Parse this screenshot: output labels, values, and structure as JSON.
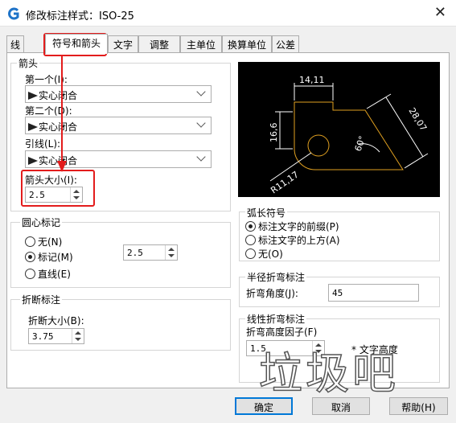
{
  "window": {
    "title": "修改标注样式：ISO-25",
    "close_glyph": "✕"
  },
  "tabs": [
    "线",
    "符号和箭头",
    "文字",
    "调整",
    "主单位",
    "换算单位",
    "公差"
  ],
  "arrowheads": {
    "group_title": "箭头",
    "first_label": "第一个(I):",
    "first_value": "实心闭合",
    "second_label": "第二个(D):",
    "second_value": "实心闭合",
    "leader_label": "引线(L):",
    "leader_value": "实心闭合",
    "size_label": "箭头大小(I):",
    "size_value": "2.5"
  },
  "center_marks": {
    "group_title": "圆心标记",
    "options": [
      "无(N)",
      "标记(M)",
      "直线(E)"
    ],
    "selected_index": 1,
    "size_value": "2.5"
  },
  "dim_break": {
    "group_title": "折断标注",
    "size_label": "折断大小(B):",
    "size_value": "3.75"
  },
  "preview": {
    "dim_top": "14,11",
    "dim_left": "16,6",
    "dim_right": "28,07",
    "dim_angle": "60°",
    "dim_radius": "R11,17",
    "line_color": "#e0a020",
    "dim_color": "#ffffff"
  },
  "arc_length": {
    "group_title": "弧长符号",
    "options": [
      "标注文字的前缀(P)",
      "标注文字的上方(A)",
      "无(O)"
    ],
    "selected_index": 0
  },
  "radius_jog": {
    "group_title": "半径折弯标注",
    "angle_label": "折弯角度(J):",
    "angle_value": "45"
  },
  "linear_jog": {
    "group_title": "线性折弯标注",
    "height_label": "折弯高度因子(F)",
    "height_value": "1.5",
    "times_text": "* 文字高度"
  },
  "watermark": "垃圾吧",
  "buttons": {
    "ok": "确定",
    "cancel": "取消",
    "help": "帮助(H)"
  },
  "colors": {
    "highlight": "#e31c1c",
    "focus": "#0078d7"
  }
}
